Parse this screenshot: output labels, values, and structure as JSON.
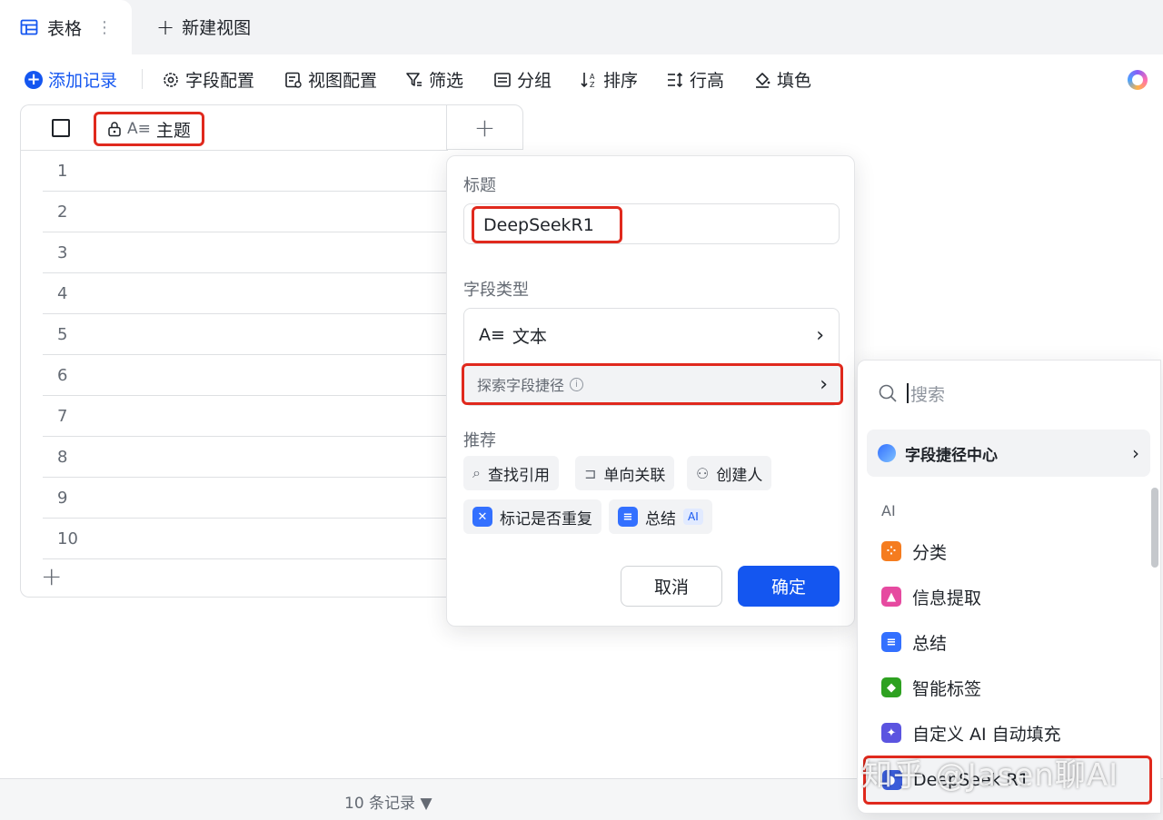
{
  "tabs": {
    "active_label": "表格",
    "more_icon": "⋮",
    "new_view_label": "新建视图"
  },
  "toolbar": {
    "add_record": "添加记录",
    "field_config": "字段配置",
    "view_config": "视图配置",
    "filter": "筛选",
    "group": "分组",
    "sort": "排序",
    "row_height": "行高",
    "fill_color": "填色"
  },
  "grid": {
    "column_title": "主题",
    "rows": [
      "1",
      "2",
      "3",
      "4",
      "5",
      "6",
      "7",
      "8",
      "9",
      "10"
    ]
  },
  "popup": {
    "title_label": "标题",
    "title_value": "DeepSeekR1",
    "field_type_label": "字段类型",
    "field_type_value": "文本",
    "explore_label": "探索字段捷径",
    "recommend_label": "推荐",
    "chips": {
      "lookup": "查找引用",
      "single_link": "单向关联",
      "creator": "创建人",
      "mark_dup": "标记是否重复",
      "summary": "总结",
      "ai_badge": "AI"
    },
    "cancel": "取消",
    "confirm": "确定"
  },
  "shortcut": {
    "search_placeholder": "搜索",
    "center_label": "字段捷径中心",
    "section_ai": "AI",
    "items": {
      "classify": "分类",
      "extract": "信息提取",
      "summary": "总结",
      "smart_tag": "智能标签",
      "custom_ai": "自定义 AI 自动填充",
      "deepseek": "DeepSeek R1"
    }
  },
  "footer": {
    "count": "10 条记录 ▼"
  },
  "watermark": "知乎 @Jasen聊AI",
  "colors": {
    "primary": "#1456f0",
    "highlight_border": "#e0291d",
    "classify_icon": "#f57c1f",
    "extract_icon": "#e64aa0",
    "summary_icon": "#3370ff",
    "tag_icon": "#2ea121",
    "custom_ai_icon": "#5b54e0"
  }
}
